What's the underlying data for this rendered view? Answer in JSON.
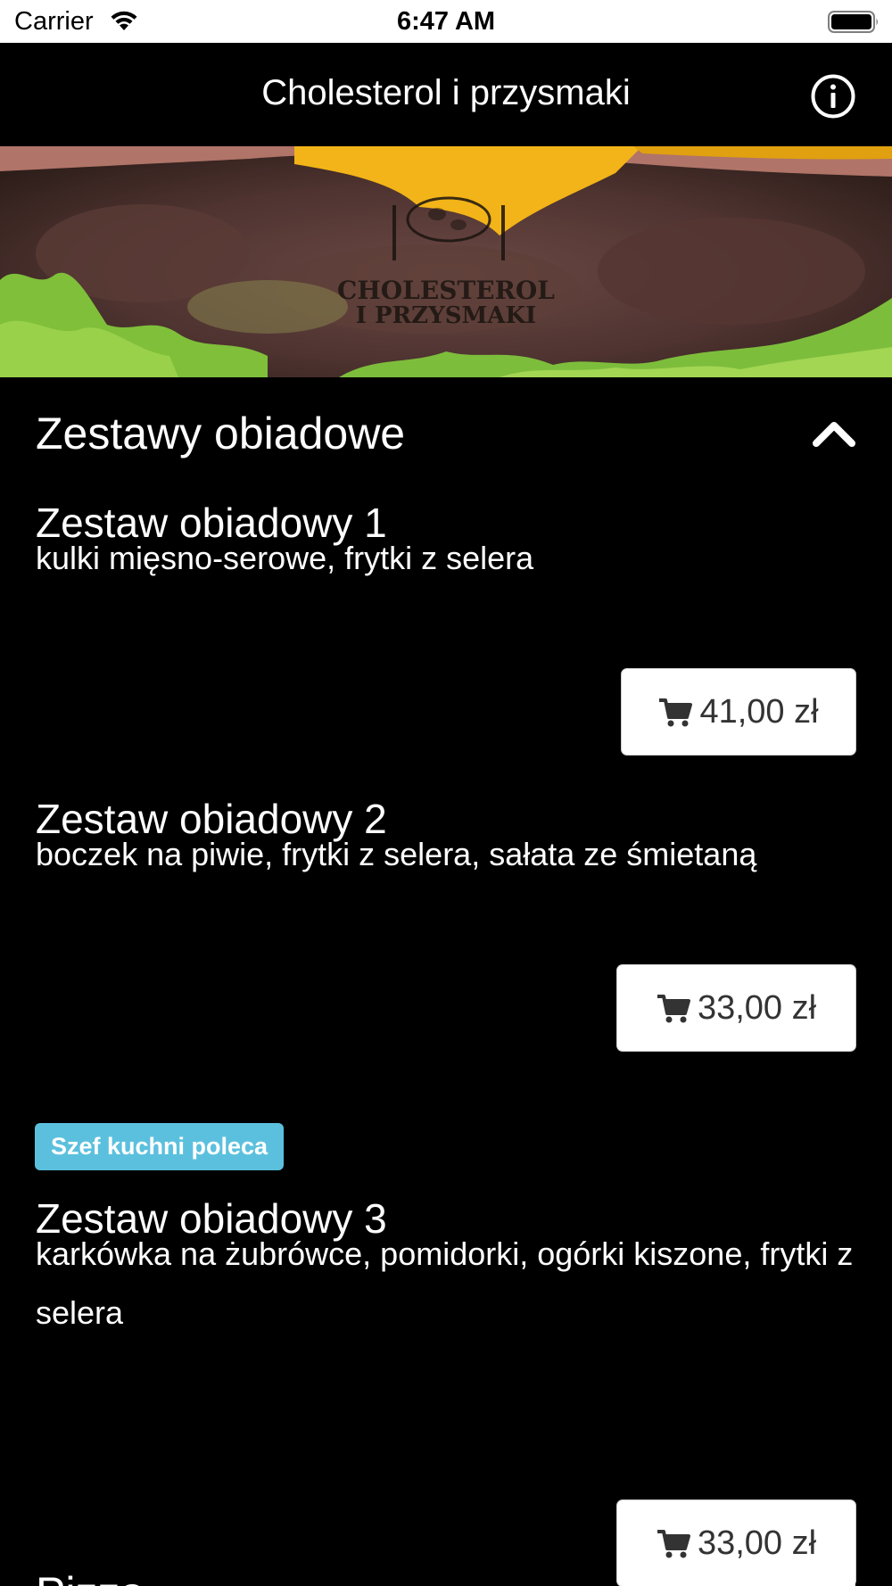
{
  "status_bar": {
    "carrier": "Carrier",
    "time": "6:47 AM"
  },
  "nav": {
    "title": "Cholesterol i przysmaki",
    "info_icon": "info-circle-icon"
  },
  "hero": {
    "logo_line1": "CHOLESTEROL",
    "logo_line2": "I PRZYSMAKI"
  },
  "sections": [
    {
      "title": "Zestawy obiadowe",
      "expanded": true,
      "items": [
        {
          "name": "Zestaw obiadowy 1",
          "description": "kulki mięsno-serowe, frytki z selera",
          "price": "41,00 zł"
        },
        {
          "name": "Zestaw obiadowy 2",
          "description": "boczek na piwie, frytki z selera, sałata ze śmietaną",
          "price": "33,00 zł"
        },
        {
          "badge": "Szef kuchni poleca",
          "name": "Zestaw obiadowy 3",
          "description": "karkówka na żubrówce, pomidorki, ogórki kiszone, frytki z selera",
          "price": "33,00 zł"
        }
      ]
    },
    {
      "title": "Pizza",
      "expanded": false
    }
  ],
  "colors": {
    "background": "#000000",
    "badge": "#5bc0de",
    "button_bg": "#ffffff",
    "button_text": "#333333"
  }
}
